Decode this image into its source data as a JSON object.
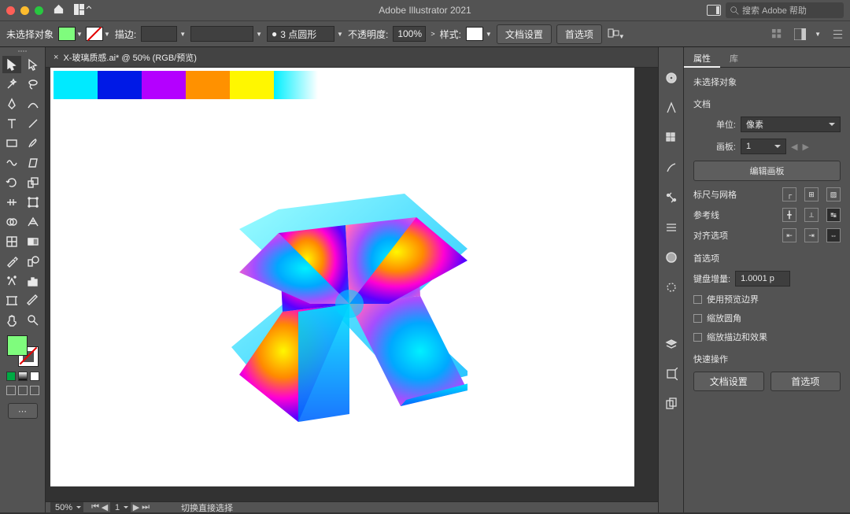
{
  "titlebar": {
    "app_title": "Adobe Illustrator 2021",
    "search_placeholder": "搜索 Adobe 帮助"
  },
  "control": {
    "selection_status": "未选择对象",
    "fill_color": "#7ffc7d",
    "stroke_label": "描边:",
    "stroke_width": "",
    "brush_profile": "3 点圆形",
    "opacity_label": "不透明度:",
    "opacity_value": "100%",
    "style_label": "样式:",
    "style_swatch": "#ffffff",
    "doc_setup": "文档设置",
    "prefs": "首选项"
  },
  "doc": {
    "tab_label": "X-玻璃质感.ai* @ 50% (RGB/预览)",
    "swatches": [
      "#00eaff",
      "#0019e6",
      "#b400ff",
      "#ff9100",
      "#fff700",
      "linear-gradient(90deg,#00f0ff,#ffffff)"
    ]
  },
  "status": {
    "zoom": "50%",
    "artboard": "1",
    "tool_hint": "切换直接选择"
  },
  "properties": {
    "tab_props": "属性",
    "tab_lib": "库",
    "no_selection": "未选择对象",
    "section_document": "文档",
    "unit_label": "单位:",
    "unit_value": "像素",
    "artboard_label": "画板:",
    "artboard_value": "1",
    "edit_artboards": "编辑画板",
    "section_rulers": "标尺与网格",
    "section_guides": "参考线",
    "section_align": "对齐选项",
    "section_prefs": "首选项",
    "kbd_incr_label": "键盘增量:",
    "kbd_incr_value": "1.0001 p",
    "chk_preview_bounds": "使用预览边界",
    "chk_scale_corners": "缩放圆角",
    "chk_scale_strokes": "缩放描边和效果",
    "section_quick": "快速操作",
    "doc_setup_btn": "文档设置",
    "prefs_btn": "首选项"
  }
}
